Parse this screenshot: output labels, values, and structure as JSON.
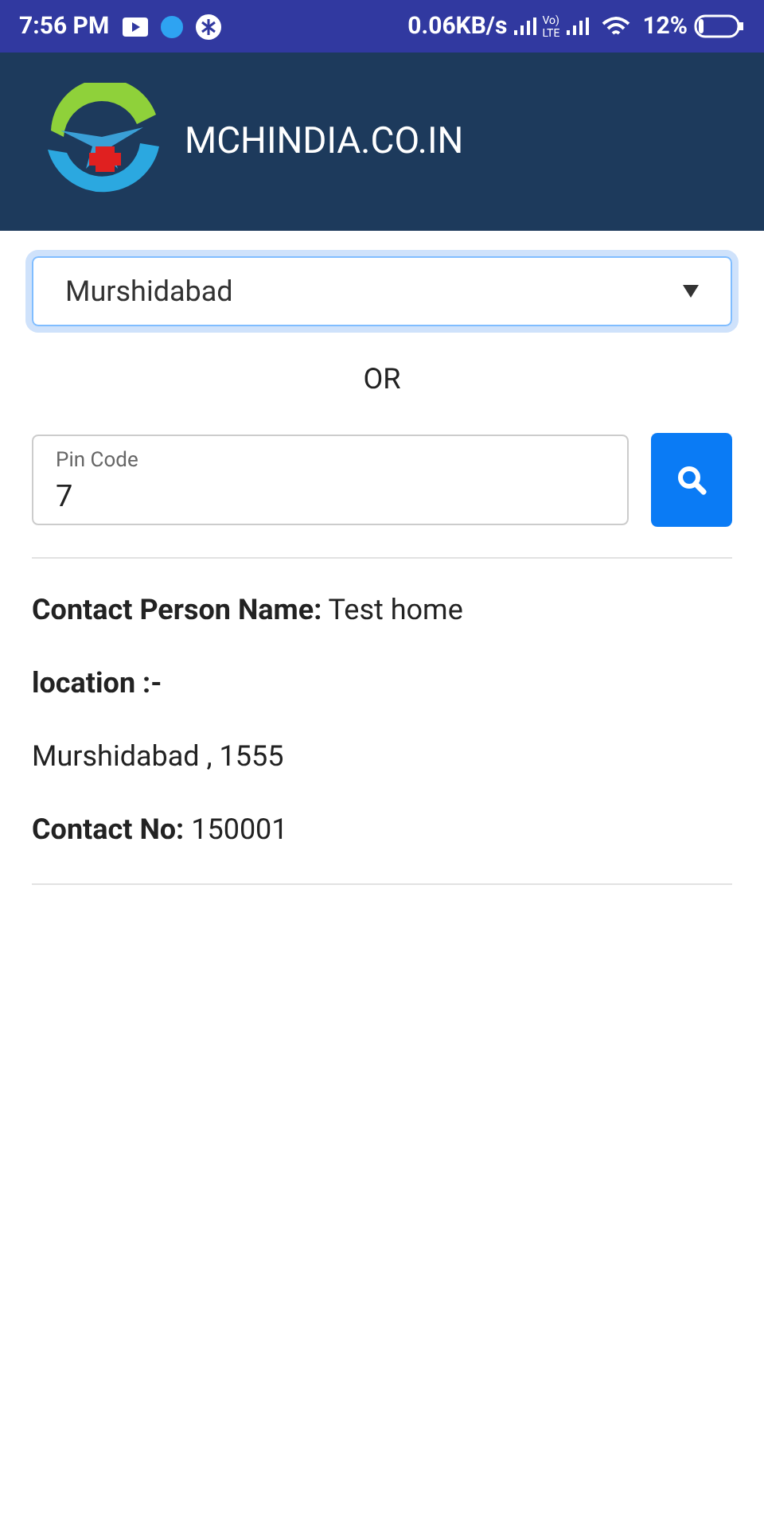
{
  "status_bar": {
    "time": "7:56 PM",
    "speed": "0.06KB/s",
    "volte_top": "Vo)",
    "volte_bottom": "LTE",
    "battery": "12%"
  },
  "header": {
    "title": "MCHINDIA.CO.IN"
  },
  "district_select": {
    "value": "Murshidabad",
    "focused": true
  },
  "separator_text": "OR",
  "pin_field": {
    "placeholder": "Pin Code",
    "value": "7"
  },
  "results": [
    {
      "kind": "pair",
      "text": "**Contact Person Name:** Test home"
    },
    {
      "kind": "heading",
      "text": "location :-"
    },
    {
      "kind": "plain",
      "text": "Murshidabad , 1555"
    },
    {
      "kind": "pair",
      "text": "**Contact No:** 150001"
    }
  ]
}
